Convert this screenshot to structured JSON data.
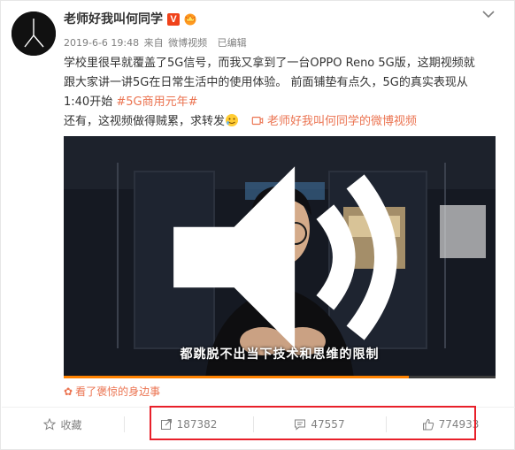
{
  "post": {
    "username": "老师好我叫何同学",
    "verified_badge": "V",
    "date": "2019-6-6 19:48",
    "source_prefix": "来自",
    "source": "微博视频",
    "edited": "已编辑",
    "text_line1": "学校里很早就覆盖了5G信号，而我又拿到了一台OPPO Reno 5G版，这期视频就",
    "text_line2": "跟大家讲一讲5G在日常生活中的使用体验。 前面铺垫有点久，5G的真实表现从",
    "text_line3_prefix": "1:40开始 ",
    "hashtag": "#5G商用元年#",
    "text_line4": "还有，这视频做得贼累，求转发",
    "video_link": "老师好我叫何同学的微博视频"
  },
  "video": {
    "subtitle": "都跳脱不出当下技术和思维的限制",
    "progress": 0.8
  },
  "recommend": {
    "text": "看了褒惊的身边事"
  },
  "actions": {
    "favorite_label": "收藏",
    "repost_count": "187382",
    "comment_count": "47557",
    "like_count": "774933"
  },
  "colors": {
    "accent": "#eb7350",
    "highlight_box": "#e8202a",
    "progress": "#ff8200"
  },
  "icons": [
    "avatar-logo",
    "verified-badge",
    "crown-icon",
    "chevron-down-icon",
    "emoji-icon",
    "video-link-icon",
    "volume-icon",
    "flower-icon",
    "star-icon",
    "repost-icon",
    "comment-icon",
    "like-icon"
  ]
}
